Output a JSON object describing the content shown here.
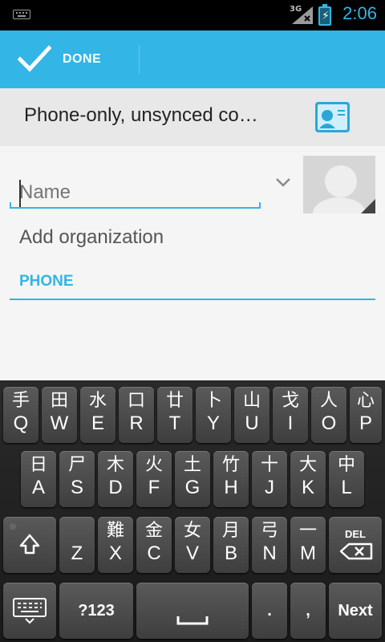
{
  "status_bar": {
    "network": "3G",
    "time": "2:06",
    "battery_color": "#33b5e5",
    "icons": [
      "keyboard-notification-icon",
      "signal-icon",
      "battery-charging-icon"
    ]
  },
  "action_bar": {
    "done_label": "DONE",
    "accent": "#33b5e5"
  },
  "account": {
    "label": "Phone-only, unsynced co…",
    "icon": "contact-card-icon"
  },
  "form": {
    "name_placeholder": "Name",
    "add_org_label": "Add organization",
    "phone_section": "PHONE"
  },
  "keyboard": {
    "row1": [
      {
        "hint": "手",
        "main": "Q"
      },
      {
        "hint": "田",
        "main": "W"
      },
      {
        "hint": "水",
        "main": "E"
      },
      {
        "hint": "口",
        "main": "R"
      },
      {
        "hint": "廿",
        "main": "T"
      },
      {
        "hint": "卜",
        "main": "Y"
      },
      {
        "hint": "山",
        "main": "U"
      },
      {
        "hint": "戈",
        "main": "I"
      },
      {
        "hint": "人",
        "main": "O"
      },
      {
        "hint": "心",
        "main": "P"
      }
    ],
    "row2": [
      {
        "hint": "日",
        "main": "A"
      },
      {
        "hint": "尸",
        "main": "S"
      },
      {
        "hint": "木",
        "main": "D"
      },
      {
        "hint": "火",
        "main": "F"
      },
      {
        "hint": "土",
        "main": "G"
      },
      {
        "hint": "竹",
        "main": "H"
      },
      {
        "hint": "十",
        "main": "J"
      },
      {
        "hint": "大",
        "main": "K"
      },
      {
        "hint": "中",
        "main": "L"
      }
    ],
    "row3": [
      {
        "hint": "",
        "main": "Z"
      },
      {
        "hint": "難",
        "main": "X"
      },
      {
        "hint": "金",
        "main": "C"
      },
      {
        "hint": "女",
        "main": "V"
      },
      {
        "hint": "月",
        "main": "B"
      },
      {
        "hint": "弓",
        "main": "N"
      },
      {
        "hint": "一",
        "main": "M"
      }
    ],
    "delete_label": "DEL",
    "symbols_label": "?123",
    "period_label": ".",
    "comma_label": ",",
    "next_label": "Next"
  }
}
